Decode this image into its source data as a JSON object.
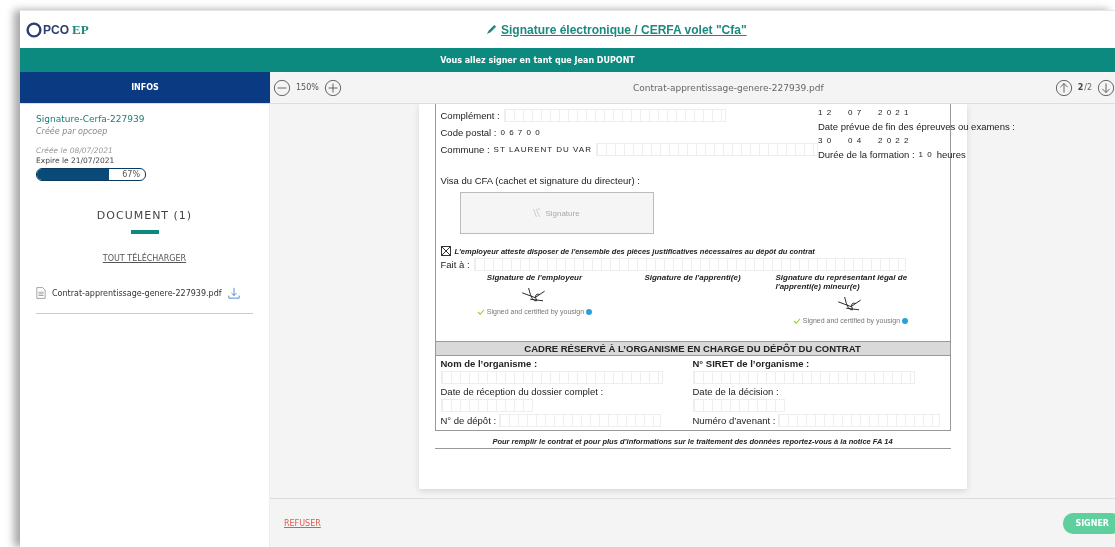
{
  "logo": {
    "letter": "PCO",
    "suffix": "EP"
  },
  "header": {
    "title": "Signature électronique / CERFA volet \"Cfa\""
  },
  "banner": "Vous allez signer en tant que Jean DUPONT",
  "sidebar_tab": "INFOS",
  "toolbar": {
    "zoom": "150%",
    "file_name": "Contrat-apprentissage-genere-227939.pdf",
    "page_current": "2",
    "page_total": "/2"
  },
  "info": {
    "name": "Signature-Cerfa-227939",
    "creator": "Créée par opcoep",
    "created": "Créée le 08/07/2021",
    "expires": "Expire le 21/07/2021",
    "progress": {
      "level": 0.67,
      "reading": "67%"
    }
  },
  "documents": {
    "heading": "DOCUMENT (1)",
    "download_all": "TOUT TÉLÉCHARGER",
    "files": [
      {
        "name": "Contrat-apprentissage-genere-227939.pdf"
      }
    ]
  },
  "pdf": {
    "left_fields": [
      {
        "label": "Complément :"
      },
      {
        "label": "Code postal :",
        "value": "0 6 7 0 0"
      },
      {
        "label": "Commune :",
        "value": "ST LAURENT DU VAR"
      }
    ],
    "start_date": [
      "1 2",
      "0 7",
      "2 0 2 1"
    ],
    "end_date_label": "Date prévue de fin des épreuves ou examens :",
    "end_date": [
      "3 0",
      "0 4",
      "2 0 2 2"
    ],
    "duration_label": "Durée de la formation :",
    "duration_value": "1 0",
    "duration_unit": "heures",
    "visa_label": "Visa du CFA (cachet et signature du directeur) :",
    "signature_placeholder": "Signature",
    "attestation": {
      "checked": true,
      "text": "L'employeur atteste disposer de l'ensemble des pièces justificatives nécessaires au dépôt du contrat"
    },
    "place_label": "Fait à :",
    "signatures": [
      {
        "heading": "Signature de l'employeur",
        "signed": true,
        "certified": "Signed and certified by yousign"
      },
      {
        "heading": "Signature de l'apprenti(e)",
        "signed": false
      },
      {
        "heading": "Signature du représentant légal de l'apprenti(e) mineur(e)",
        "signed": true,
        "certified": "Signed and certified by yousign"
      }
    ],
    "section_title": "CADRE RÉSERVÉ À L’ORGANISME EN CHARGE DU DÉPÔT DU CONTRAT",
    "org_fields": [
      {
        "label": "Nom de l’organisme :",
        "kind": "bold"
      },
      {
        "label": "N° SIRET de l’organisme :",
        "kind": "bold"
      },
      {
        "label": "Date de réception du dossier complet :",
        "kind": "date"
      },
      {
        "label": "Date de la décision :",
        "kind": "date"
      },
      {
        "label": "N° de dépôt :",
        "kind": "inline"
      },
      {
        "label": "Numéro d’avenant :",
        "kind": "inline"
      }
    ],
    "note": "Pour remplir le contrat et pour plus d’informations sur le traitement des données  reportez-vous à la notice FA 14"
  },
  "footer": {
    "refuse": "REFUSER",
    "sign": "SIGNER"
  }
}
